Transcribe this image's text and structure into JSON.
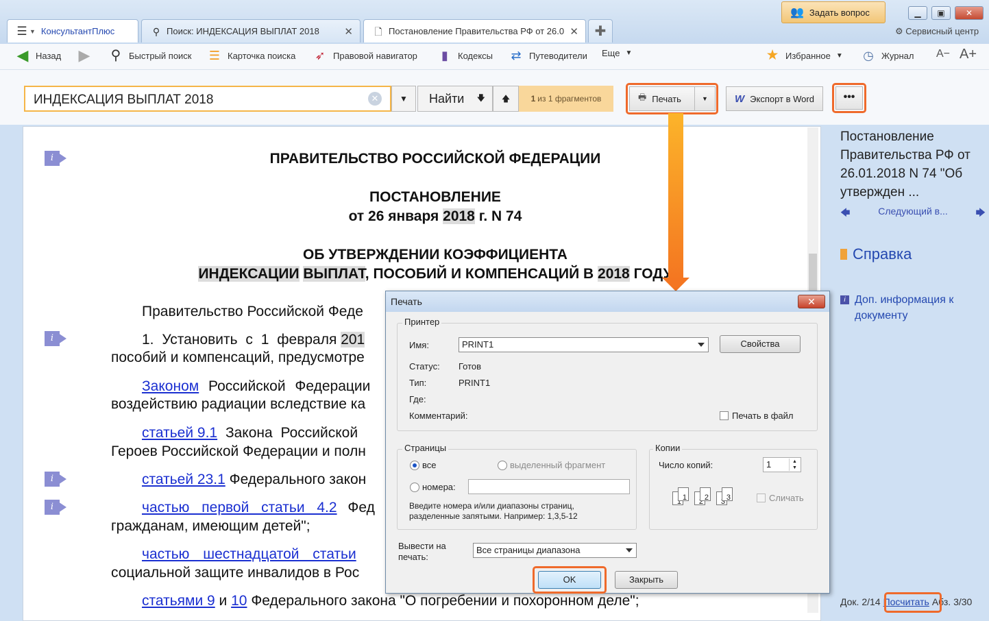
{
  "app": {
    "brand_tab": "КонсультантПлюс",
    "tabs": [
      {
        "label": "Поиск: ИНДЕКСАЦИЯ ВЫПЛАТ 2018"
      },
      {
        "label": "Постановление Правительства РФ от 26.0"
      }
    ],
    "ask_question": "Задать вопрос",
    "service_center": "Сервисный центр"
  },
  "toolbar": {
    "back": "Назад",
    "quick_search": "Быстрый поиск",
    "search_card": "Карточка поиска",
    "legal_navigator": "Правовой навигатор",
    "codes": "Кодексы",
    "guides": "Путеводители",
    "more": "Еще",
    "favorites": "Избранное",
    "journal": "Журнал",
    "font_smaller": "A−",
    "font_larger": "A+"
  },
  "search": {
    "query": "ИНДЕКСАЦИЯ ВЫПЛАТ 2018",
    "find": "Найти",
    "fragments_count": "1",
    "fragments_text": "из 1 фрагментов",
    "print": "Печать",
    "export_word": "Экспорт в Word",
    "more": "•••"
  },
  "document": {
    "gov": "ПРАВИТЕЛЬСТВО РОССИЙСКОЙ ФЕДЕРАЦИИ",
    "decree": "ПОСТАНОВЛЕНИЕ",
    "date_prefix": "от 26 января",
    "date_year": "2018",
    "date_suffix": "г. N 74",
    "title1": "ОБ УТВЕРЖДЕНИИ КОЭФФИЦИЕНТА",
    "t2_w1": "ИНДЕКСАЦИИ",
    "t2_w2": "ВЫПЛАТ",
    "t2_mid": ", ПОСОБИЙ И КОМПЕНСАЦИЙ В",
    "t2_year": "2018",
    "t2_end": "ГОДУ",
    "p1": "Правительство Российской Феде",
    "p2_a": "1. Установить с 1 февраля",
    "p2_year": "201",
    "p3": "пособий и компенсаций, предусмотре",
    "l1_link": "Законом",
    "l1_text": " Российской Федерации",
    "l1_cont": "воздействию радиации вследствие ка",
    "l2_link": "статьей 9.1",
    "l2_text": " Закона Российской",
    "l2_cont": "Героев Российской Федерации и полн",
    "l3_link": "статьей 23.1",
    "l3_text": " Федерального закон",
    "l4_link": "частью первой статьи 4.2",
    "l4_text": " Фед",
    "l4_cont": "гражданам, имеющим детей\";",
    "l5_link": "частью шестнадцатой статьи",
    "l5_cont": "социальной защите инвалидов в Рос",
    "l6_link1": "статьями 9",
    "l6_and": " и ",
    "l6_link2": "10",
    "l6_text": " Федерального закона \"О погребении и похоронном деле\";"
  },
  "right_panel": {
    "doc_title": "Постановление Правительства РФ от 26.01.2018 N 74 \"Об утвержден ...",
    "next": "Следующий в...",
    "help": "Справка",
    "add_info": "Доп. информация к документу",
    "status_doc": "Док. 2/14",
    "calc": "Посчитать",
    "status_par": "Абз. 3/30"
  },
  "print_dialog": {
    "title": "Печать",
    "printer_group": "Принтер",
    "name_label": "Имя:",
    "printer_name": "PRINT1",
    "properties": "Свойства",
    "status_label": "Статус:",
    "status_value": "Готов",
    "type_label": "Тип:",
    "type_value": "PRINT1",
    "where_label": "Где:",
    "comment_label": "Комментарий:",
    "print_to_file": "Печать в файл",
    "pages_group": "Страницы",
    "all": "все",
    "selection": "выделенный фрагмент",
    "numbers": "номера:",
    "hint": "Введите номера и/или диапазоны страниц, разделенные запятыми. Например: 1,3,5-12",
    "copies_group": "Копии",
    "copies_label": "Число копий:",
    "copies_value": "1",
    "collate": "Сличать",
    "output_label": "Вывести на печать:",
    "output_value": "Все страницы диапазона",
    "ok": "OK",
    "close": "Закрыть"
  },
  "colors": {
    "highlight": "#ef6a2b",
    "link": "#1a2fd1",
    "search_border": "#f5b547"
  }
}
